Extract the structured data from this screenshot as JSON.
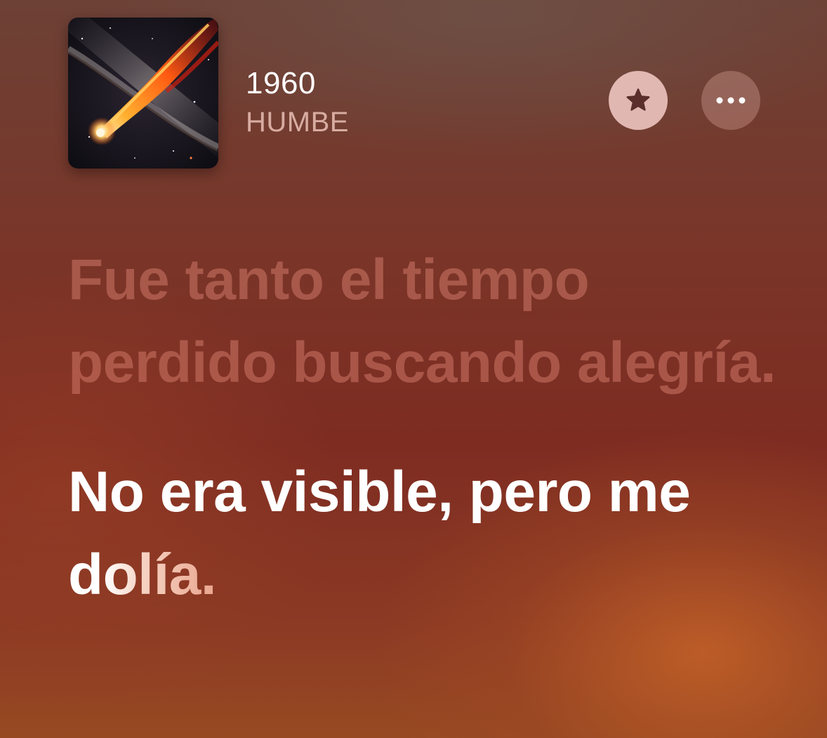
{
  "now_playing": {
    "title": "1960",
    "artist": "HUMBE",
    "artwork_icon": "comet-artwork"
  },
  "actions": {
    "favorite_icon": "star-icon",
    "more_icon": "ellipsis-icon"
  },
  "lyrics": {
    "previous_line": "Fue tanto el tiempo perdido buscando alegría.",
    "current_line_sung": "No era visible, pero me d",
    "current_line_unsung": "olía."
  },
  "colors": {
    "background_top": "#6d4136",
    "background_mid": "#7e2c22",
    "background_glow": "#c46228",
    "past_lyric": "#e68c7d",
    "current_lyric": "#ffffff",
    "favorite_button": "#f0c8c3"
  }
}
